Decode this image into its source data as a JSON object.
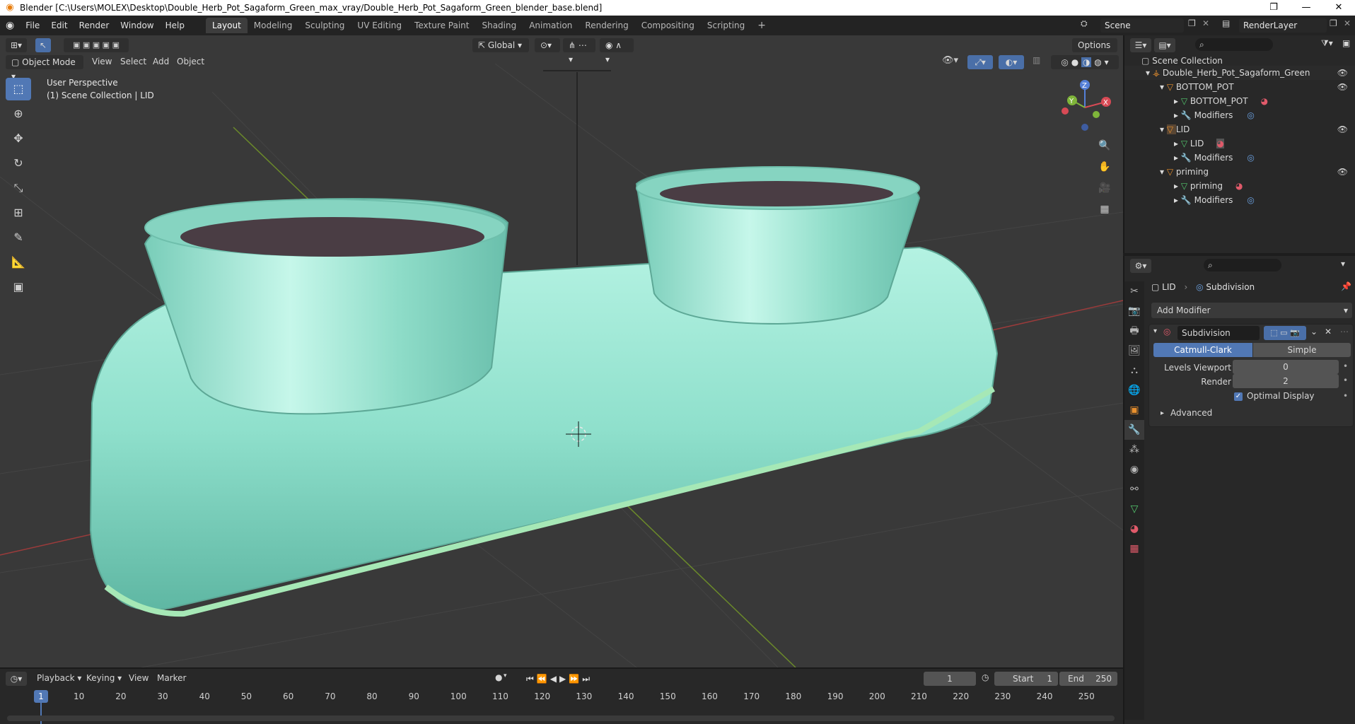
{
  "window": {
    "title": "Blender [C:\\Users\\MOLEX\\Desktop\\Double_Herb_Pot_Sagaform_Green_max_vray/Double_Herb_Pot_Sagaform_Green_blender_base.blend]",
    "minimize": "—",
    "maximize": "❐",
    "close": "✕"
  },
  "menubar": {
    "items": [
      "File",
      "Edit",
      "Render",
      "Window",
      "Help"
    ],
    "workspaces": [
      "Layout",
      "Modeling",
      "Sculpting",
      "UV Editing",
      "Texture Paint",
      "Shading",
      "Animation",
      "Rendering",
      "Compositing",
      "Scripting"
    ],
    "add_tab": "+",
    "scene_label": "Scene",
    "render_layer": "RenderLayer"
  },
  "viewport": {
    "mode": "Object Mode",
    "menus": [
      "View",
      "Select",
      "Add",
      "Object"
    ],
    "transform_orientation": "Global",
    "options": "Options",
    "perspective": "User Perspective",
    "collection_info": "(1) Scene Collection | LID",
    "gizmo": {
      "x": "X",
      "y": "Y",
      "z": "Z"
    }
  },
  "outliner": {
    "root": "Scene Collection",
    "rows": [
      {
        "label": "Double_Herb_Pot_Sagaform_Green",
        "depth": 1
      },
      {
        "label": "BOTTOM_POT",
        "depth": 2
      },
      {
        "label": "BOTTOM_POT",
        "depth": 3
      },
      {
        "label": "Modifiers",
        "depth": 3
      },
      {
        "label": "LID",
        "depth": 2
      },
      {
        "label": "LID",
        "depth": 3
      },
      {
        "label": "Modifiers",
        "depth": 3
      },
      {
        "label": "priming",
        "depth": 2
      },
      {
        "label": "priming",
        "depth": 3
      },
      {
        "label": "Modifiers",
        "depth": 3
      }
    ]
  },
  "properties": {
    "object": "LID",
    "modifier_name": "Subdivision",
    "add_modifier": "Add Modifier",
    "modifier_field": "Subdivision",
    "catmull": "Catmull-Clark",
    "simple": "Simple",
    "levels_viewport_label": "Levels Viewport",
    "levels_viewport_value": "0",
    "render_label": "Render",
    "render_value": "2",
    "optimal_display": "Optimal Display",
    "advanced": "Advanced"
  },
  "timeline": {
    "menus": [
      "Playback",
      "Keying",
      "View",
      "Marker"
    ],
    "current_frame": "1",
    "start_label": "Start",
    "start_value": "1",
    "end_label": "End",
    "end_value": "250",
    "marker_frame": "1",
    "ticks": [
      "10",
      "20",
      "30",
      "40",
      "50",
      "60",
      "70",
      "80",
      "90",
      "100",
      "110",
      "120",
      "130",
      "140",
      "150",
      "160",
      "170",
      "180",
      "190",
      "200",
      "210",
      "220",
      "230",
      "240",
      "250"
    ]
  },
  "colors": {
    "accent": "#5178b5",
    "pot": "#8fe0cc",
    "soil": "#4a3d44"
  }
}
